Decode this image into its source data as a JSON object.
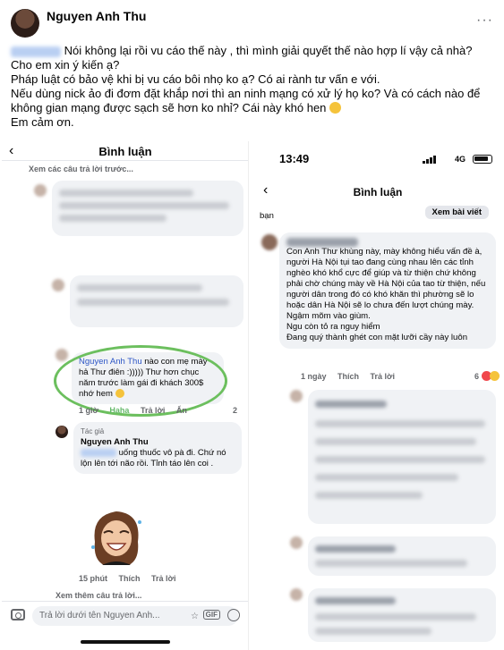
{
  "post": {
    "author": "Nguyen Anh Thu",
    "more_label": "···",
    "text_lines": [
      "Nói không lại rồi vu cáo thế này , thì mình giải quyết thế nào hợp lí vậy cả nhà? Cho em xin ý kiến ạ?",
      "Pháp luật có bảo vệ khi bị vu cáo bôi nhọ ko ạ? Có ai rành tư vấn e với.",
      "Nếu dùng nick ảo đi đơm đặt khắp nơi thì an ninh mạng có xử lý họ ko? Và có cách nào để không gian mạng được sạch sẽ hơn ko nhỉ? Cái này khó hen",
      "Em cảm ơn."
    ]
  },
  "left_screenshot": {
    "title": "Bình luận",
    "see_previous": "Xem các câu trả lời trước...",
    "highlight_name": "Nguyen Anh Thu",
    "highlight_text": "nào con mẹ mày hả Thư điên :))))) Thư hơn chục năm trước làm gái đi khách 300$ nhớ hem",
    "highlight_meta": [
      "1 giờ",
      "Haha",
      "Trả lời",
      "Ẩn"
    ],
    "highlight_reaction_count": "2",
    "author_badge": "Tác giả",
    "reply_author": "Nguyen Anh Thu",
    "reply_text": "uống thuốc vô pà đi. Chứ nó lộn lên tới não rồi. Tỉnh táo lên coi .",
    "sticker_meta": [
      "15 phút",
      "Thích",
      "Trả lời"
    ],
    "see_more": "Xem thêm câu trả lời...",
    "input_placeholder": "Trả lời dưới tên Nguyen Anh...",
    "gif_label": "GIF"
  },
  "right_screenshot": {
    "time": "13:49",
    "network": "4G",
    "title": "Bình luận",
    "see_post": "Xem bài viết",
    "fragment": "bạn",
    "main_comment": "Con Anh Thư khùng này, mày không hiểu vấn đề à, người Hà Nội tụi tao đang cùng nhau lên các tỉnh nghèo khó khổ cực để giúp và từ thiện chứ không phải chờ chúng mày về Hà Nội của tao từ thiện, nếu người dân trong đó có khó khăn thì phường sẽ lo hoặc dân Hà Nội sẽ lo chưa đến lượt chúng mày.\nNgậm mõm vào giùm.\nNgu còn tỏ ra nguy hiểm\nĐang quý thành ghét con mặt lưỡi cầy này luôn",
    "main_meta": [
      "1 ngày",
      "Thích",
      "Trả lời"
    ],
    "reaction_count": "6"
  }
}
